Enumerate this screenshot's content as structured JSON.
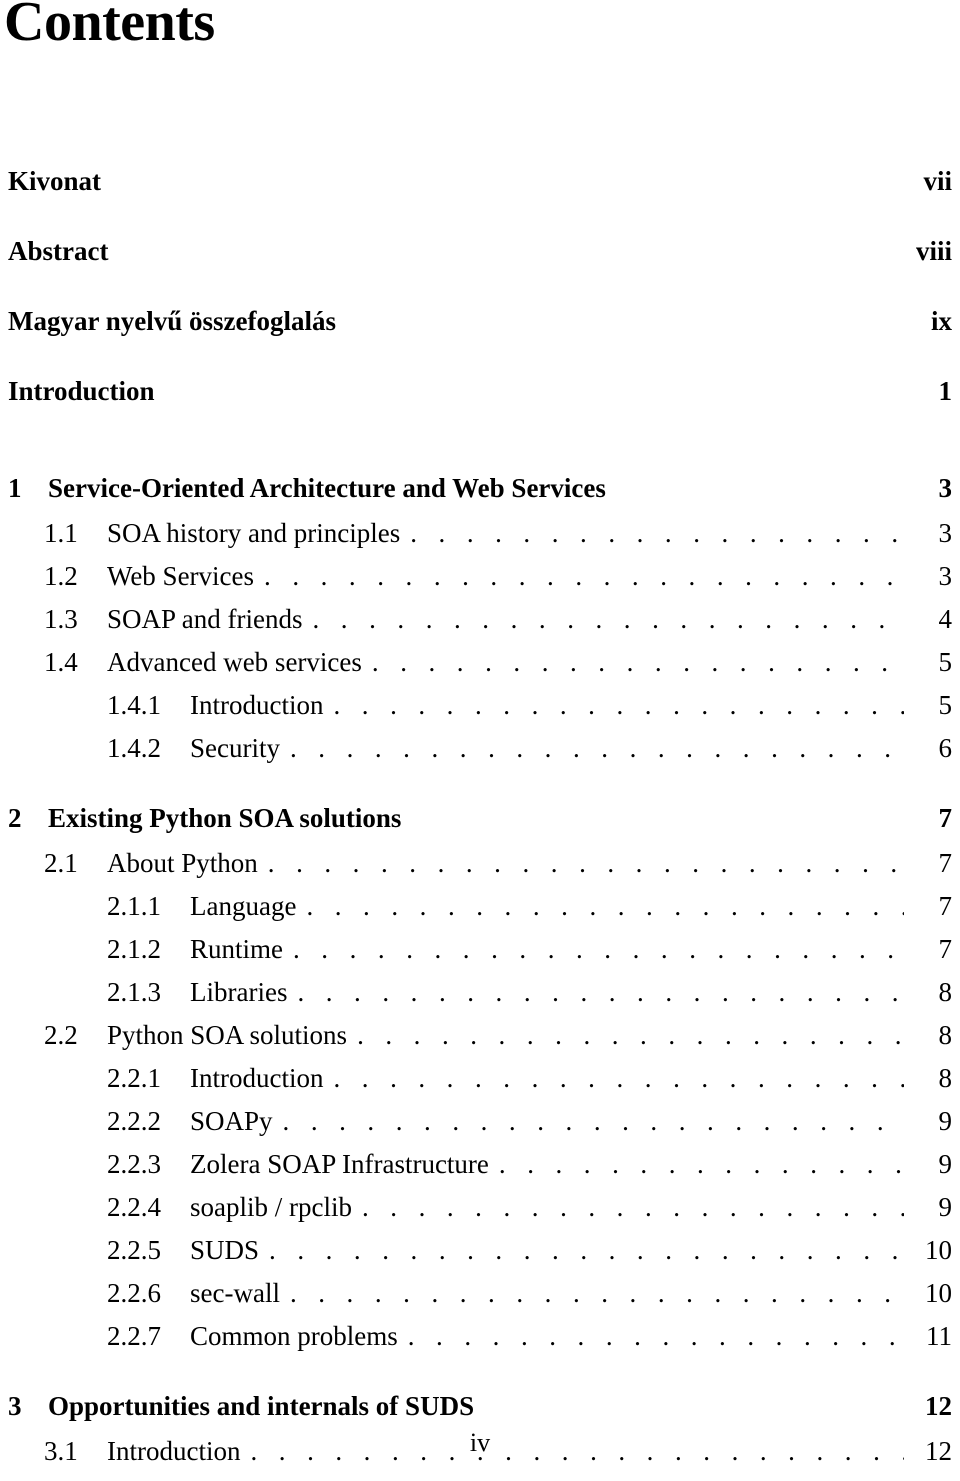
{
  "document": {
    "title": "Contents",
    "folio": "iv"
  },
  "entries": [
    {
      "level": "front",
      "number": "",
      "label": "Kivonat",
      "page": "vii"
    },
    {
      "level": "front",
      "number": "",
      "label": "Abstract",
      "page": "viii"
    },
    {
      "level": "front",
      "number": "",
      "label": "Magyar nyelvű összefoglalás",
      "page": "ix"
    },
    {
      "level": "front",
      "number": "",
      "label": "Introduction",
      "page": "1"
    },
    {
      "level": "chapter",
      "number": "1",
      "label": "Service-Oriented Architecture and Web Services",
      "page": "3"
    },
    {
      "level": "section",
      "number": "1.1",
      "label": "SOA history and principles",
      "page": "3"
    },
    {
      "level": "section",
      "number": "1.2",
      "label": "Web Services",
      "page": "3"
    },
    {
      "level": "section",
      "number": "1.3",
      "label": "SOAP and friends",
      "page": "4"
    },
    {
      "level": "section",
      "number": "1.4",
      "label": "Advanced web services",
      "page": "5"
    },
    {
      "level": "subsection",
      "number": "1.4.1",
      "label": "Introduction",
      "page": "5"
    },
    {
      "level": "subsection",
      "number": "1.4.2",
      "label": "Security",
      "page": "6"
    },
    {
      "level": "chapter",
      "number": "2",
      "label": "Existing Python SOA solutions",
      "page": "7"
    },
    {
      "level": "section",
      "number": "2.1",
      "label": "About Python",
      "page": "7"
    },
    {
      "level": "subsection",
      "number": "2.1.1",
      "label": "Language",
      "page": "7"
    },
    {
      "level": "subsection",
      "number": "2.1.2",
      "label": "Runtime",
      "page": "7"
    },
    {
      "level": "subsection",
      "number": "2.1.3",
      "label": "Libraries",
      "page": "8"
    },
    {
      "level": "section",
      "number": "2.2",
      "label": "Python SOA solutions",
      "page": "8"
    },
    {
      "level": "subsection",
      "number": "2.2.1",
      "label": "Introduction",
      "page": "8"
    },
    {
      "level": "subsection",
      "number": "2.2.2",
      "label": "SOAPy",
      "page": "9"
    },
    {
      "level": "subsection",
      "number": "2.2.3",
      "label": "Zolera SOAP Infrastructure",
      "page": "9"
    },
    {
      "level": "subsection",
      "number": "2.2.4",
      "label": "soaplib / rpclib",
      "page": "9"
    },
    {
      "level": "subsection",
      "number": "2.2.5",
      "label": "SUDS",
      "page": "10"
    },
    {
      "level": "subsection",
      "number": "2.2.6",
      "label": "sec-wall",
      "page": "10"
    },
    {
      "level": "subsection",
      "number": "2.2.7",
      "label": "Common problems",
      "page": "11"
    },
    {
      "level": "chapter",
      "number": "3",
      "label": "Opportunities and internals of SUDS",
      "page": "12"
    },
    {
      "level": "section",
      "number": "3.1",
      "label": "Introduction",
      "page": "12"
    }
  ]
}
